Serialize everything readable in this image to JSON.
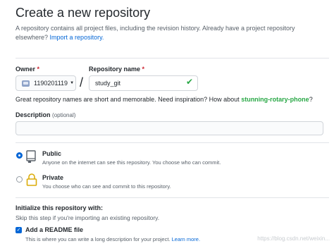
{
  "page": {
    "title": "Create a new repository",
    "subtitle": "A repository contains all project files, including the revision history. Already have a project repository elsewhere?",
    "import_link": "Import a repository."
  },
  "owner": {
    "label": "Owner",
    "required_mark": "*",
    "value": "1190201119"
  },
  "repository": {
    "label": "Repository name",
    "required_mark": "*",
    "value": "study_git",
    "separator": "/"
  },
  "hint": {
    "text": "Great repository names are short and memorable. Need inspiration? How about",
    "suggestion": "stunning-rotary-phone",
    "end": "?"
  },
  "description": {
    "label": "Description",
    "optional": "(optional)",
    "value": ""
  },
  "visibility": {
    "public": {
      "title": "Public",
      "desc": "Anyone on the internet can see this repository. You choose who can commit.",
      "selected": true
    },
    "private": {
      "title": "Private",
      "desc": "You choose who can see and commit to this repository.",
      "selected": false
    }
  },
  "init": {
    "title": "Initialize this repository with:",
    "desc": "Skip this step if you're importing an existing repository.",
    "readme_label": "Add a README file",
    "readme_desc": "This is where you can write a long description for your project.",
    "learn_more": "Learn more.",
    "readme_checked": true
  },
  "watermark": "https://blog.csdn.net/weixin...",
  "colors": {
    "link": "#0366d6",
    "success": "#28a745",
    "required": "#cb2431"
  }
}
